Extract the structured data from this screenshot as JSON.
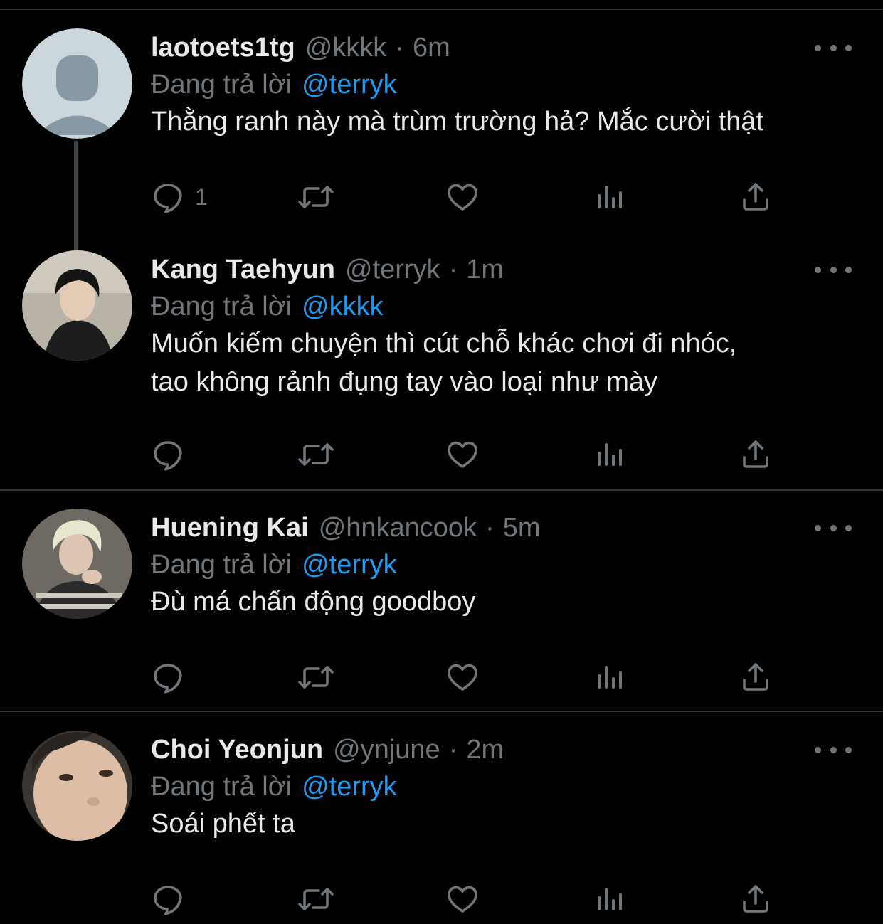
{
  "labels": {
    "replying_to": "Đang trả lời"
  },
  "tweets": [
    {
      "name": "laotoets1tg",
      "handle": "@kkkk",
      "dot": "·",
      "time": "6m",
      "replying_to": "@terryk",
      "text": "Thằng ranh này mà trùm trường hả? Mắc cười thật",
      "reply_count": "1",
      "avatar": "default-avatar"
    },
    {
      "name": "Kang Taehyun",
      "handle": "@terryk",
      "dot": "·",
      "time": "1m",
      "replying_to": "@kkkk",
      "text": "Muốn kiếm chuyện thì cút chỗ khác chơi đi nhóc,\ntao không rảnh đụng tay vào loại như mày",
      "reply_count": "",
      "avatar": "photo-avatar"
    },
    {
      "name": "Huening Kai",
      "handle": "@hnkancook",
      "dot": "·",
      "time": "5m",
      "replying_to": "@terryk",
      "text": "Đù má chấn động goodboy",
      "reply_count": "",
      "avatar": "photo-avatar"
    },
    {
      "name": "Choi Yeonjun",
      "handle": "@ynjune",
      "dot": "·",
      "time": "2m",
      "replying_to": "@terryk",
      "text": "Soái phết ta",
      "reply_count": "",
      "avatar": "photo-avatar"
    }
  ],
  "icons": {
    "actions": [
      "reply-icon",
      "retweet-icon",
      "like-icon",
      "views-icon",
      "share-icon"
    ],
    "more": "more-options-icon"
  },
  "colors": {
    "background": "#000000",
    "primary_text": "#e7e9ea",
    "secondary_text": "#71767b",
    "mention": "#1d9bf0",
    "divider": "#2f3336"
  }
}
